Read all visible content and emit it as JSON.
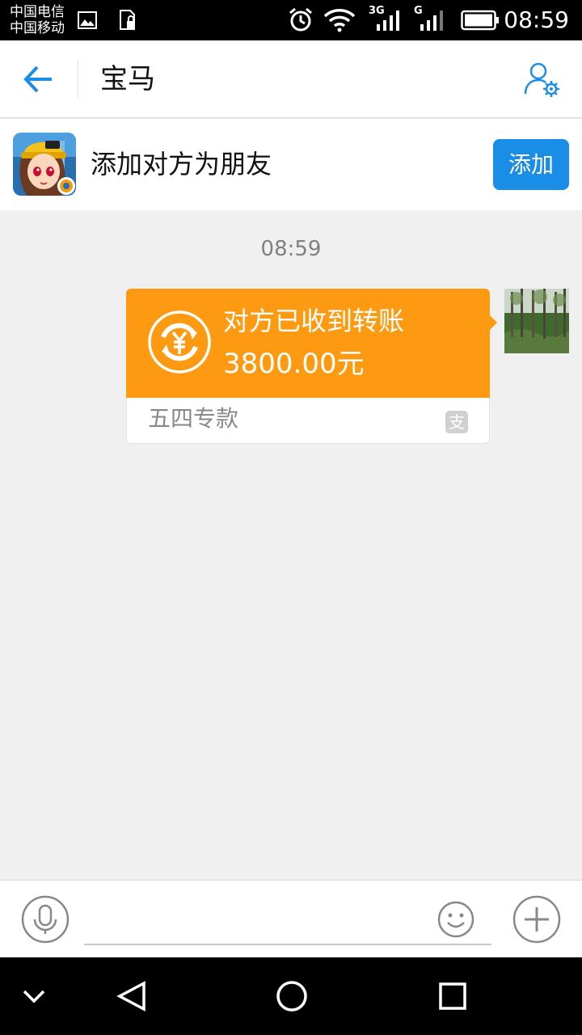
{
  "status_bar": {
    "carrier_1": "中国电信",
    "carrier_2": "中国移动",
    "network_1": "3G",
    "network_2": "G",
    "time": "08:59"
  },
  "header": {
    "title": "宝马",
    "icons": [
      "back-arrow-icon",
      "profile-settings-icon"
    ]
  },
  "add_friend": {
    "text": "添加对方为朋友",
    "button_label": "添加"
  },
  "chat": {
    "timestamp": "08:59",
    "transfer": {
      "status": "对方已收到转账",
      "amount": "3800.00元",
      "note": "五四专款",
      "badge": "支"
    }
  },
  "input_bar": {
    "value": "",
    "icons": [
      "microphone-icon",
      "emoji-icon",
      "plus-icon"
    ]
  },
  "colors": {
    "accent": "#1a8ee6",
    "transfer_orange": "#fd9a11",
    "chat_background": "#f0f0f0"
  }
}
